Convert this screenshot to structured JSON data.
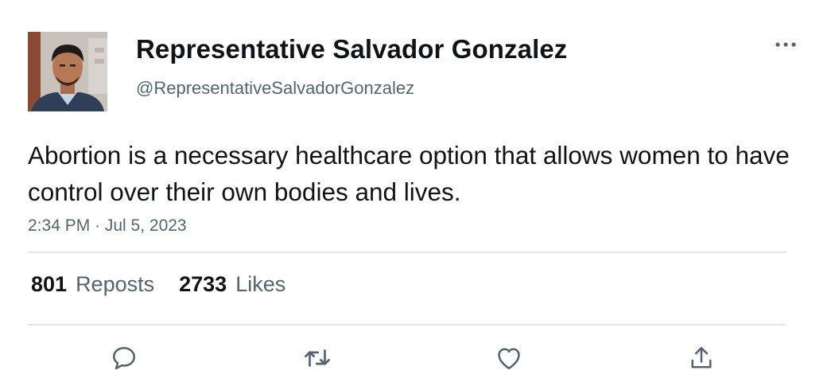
{
  "author": {
    "display_name": "Representative Salvador Gonzalez",
    "handle": "@RepresentativeSalvadorGonzalez"
  },
  "tweet": {
    "text": "Abortion is a necessary healthcare option that allows women to have control over their own bodies and lives.",
    "timestamp": "2:34 PM · Jul 5, 2023"
  },
  "stats": {
    "reposts_count": "801",
    "reposts_label": "Reposts",
    "likes_count": "2733",
    "likes_label": "Likes"
  },
  "icons": {
    "more": "more-horizontal-icon",
    "reply": "reply-icon",
    "repost": "repost-icon",
    "like": "heart-icon",
    "share": "share-icon"
  },
  "colors": {
    "text_primary": "#0f1419",
    "text_secondary": "#536471",
    "divider": "#e1e6ea"
  }
}
